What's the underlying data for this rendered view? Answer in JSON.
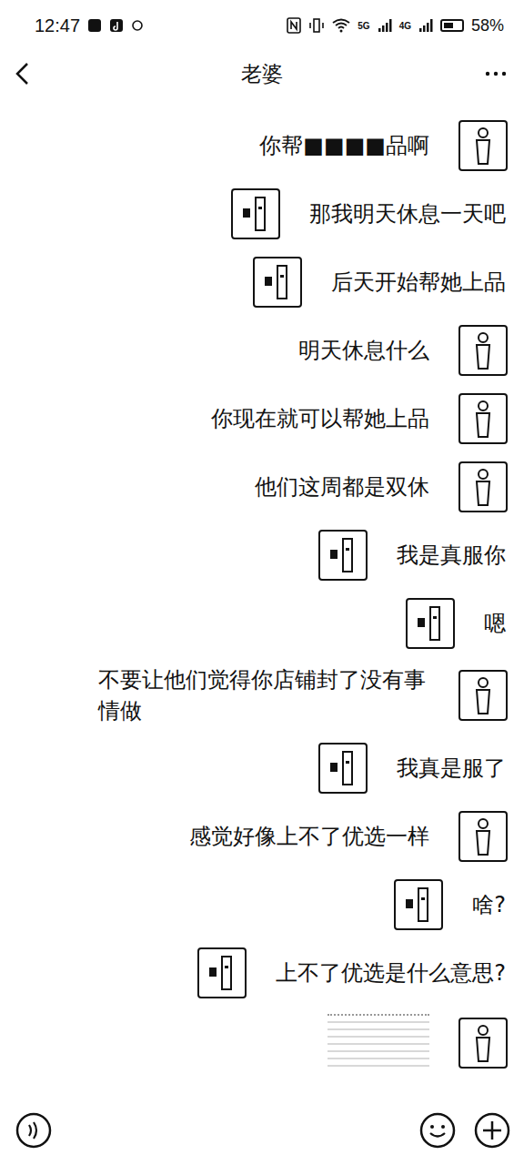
{
  "status_bar": {
    "time": "12:47",
    "signal_labels": [
      "5G",
      "4G"
    ],
    "battery": "58%",
    "battery_level": 0.58
  },
  "header": {
    "title": "老婆"
  },
  "messages": [
    {
      "sender": "me",
      "kind": "text",
      "text": "你帮■■■■品啊"
    },
    {
      "sender": "other",
      "kind": "text",
      "text": "那我明天休息一天吧"
    },
    {
      "sender": "other",
      "kind": "text",
      "text": "后天开始帮她上品"
    },
    {
      "sender": "me",
      "kind": "text",
      "text": "明天休息什么"
    },
    {
      "sender": "me",
      "kind": "text",
      "text": "你现在就可以帮她上品"
    },
    {
      "sender": "me",
      "kind": "text",
      "text": "他们这周都是双休"
    },
    {
      "sender": "other",
      "kind": "text",
      "text": "我是真服你"
    },
    {
      "sender": "other",
      "kind": "text",
      "text": "嗯"
    },
    {
      "sender": "me",
      "kind": "text",
      "text": "不要让他们觉得你店铺封了没有事情做"
    },
    {
      "sender": "other",
      "kind": "text",
      "text": "我真是服了"
    },
    {
      "sender": "me",
      "kind": "text",
      "text": "感觉好像上不了优选一样"
    },
    {
      "sender": "other",
      "kind": "text",
      "text": "啥?"
    },
    {
      "sender": "other",
      "kind": "text",
      "text": "上不了优选是什么意思?"
    },
    {
      "sender": "me",
      "kind": "image"
    }
  ]
}
